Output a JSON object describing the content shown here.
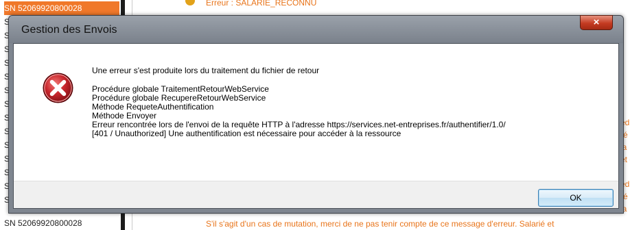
{
  "background": {
    "list_items": [
      "SN 52069920800028",
      "S",
      "S",
      "S",
      "S",
      "S",
      "S",
      "S",
      "S",
      "S",
      "S",
      "S",
      "S",
      "S",
      "S",
      "SN 52069920800028"
    ],
    "top_error_text": "Erreur : SALARIE_RECONNU",
    "right_fragments": [
      "éd",
      "ré",
      "la",
      "et d",
      "éd",
      "ré",
      "la"
    ],
    "bottom_message": "S'il s'agit d'un cas de mutation, merci de ne pas tenir compte de ce message d'erreur. Salarié et"
  },
  "dialog": {
    "title": "Gestion des Envois",
    "icon": "error-icon",
    "close_symbol": "×",
    "message_header": "Une erreur s'est produite lors du traitement du fichier de retour",
    "message_lines": [
      "Procédure globale TraitementRetourWebService",
      "Procédure globale RecupereRetourWebService",
      "Méthode RequeteAuthentification",
      "Méthode Envoyer",
      "Erreur rencontrée lors de l'envoi de la requête HTTP  à l'adresse https://services.net-entreprises.fr/authentifier/1.0/",
      "[401 / Unauthorized] Une authentification est nécessaire pour accéder à la ressource"
    ],
    "ok_label": "OK"
  },
  "colors": {
    "selected_row": "#f0782a",
    "warning_text": "#e8741a",
    "close_button": "#c43b22",
    "error_icon": "#c8262d"
  }
}
